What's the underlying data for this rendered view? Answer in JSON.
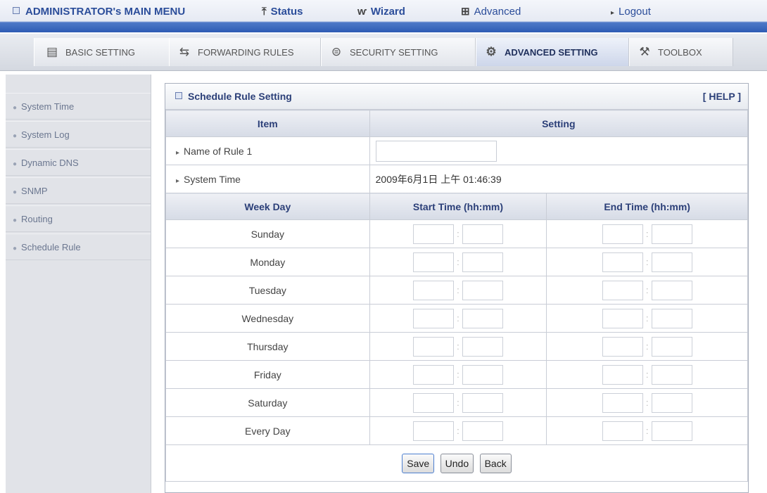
{
  "top_menu": {
    "admin": "ADMINISTRATOR's MAIN MENU",
    "status": "Status",
    "wizard": "Wizard",
    "advanced": "Advanced",
    "logout": "Logout"
  },
  "tabs": [
    {
      "label": "BASIC SETTING",
      "icon": "folder-icon"
    },
    {
      "label": "FORWARDING RULES",
      "icon": "arrows-icon"
    },
    {
      "label": "SECURITY SETTING",
      "icon": "lock-icon"
    },
    {
      "label": "ADVANCED SETTING",
      "icon": "settings-icon",
      "active": true
    },
    {
      "label": "TOOLBOX",
      "icon": "toolbox-icon"
    }
  ],
  "sidebar": {
    "items": [
      {
        "label": "System Time"
      },
      {
        "label": "System Log"
      },
      {
        "label": "Dynamic DNS"
      },
      {
        "label": "SNMP"
      },
      {
        "label": "Routing"
      },
      {
        "label": "Schedule Rule"
      }
    ]
  },
  "panel": {
    "title": "Schedule Rule Setting",
    "help": "[ HELP ]",
    "col_item": "Item",
    "col_setting": "Setting",
    "name_label": "Name of Rule 1",
    "name_value": "",
    "time_label": "System Time",
    "time_value": "2009年6月1日 上午 01:46:39",
    "col_weekday": "Week Day",
    "col_start": "Start Time (hh:mm)",
    "col_end": "End Time (hh:mm)",
    "days": [
      "Sunday",
      "Monday",
      "Tuesday",
      "Wednesday",
      "Thursday",
      "Friday",
      "Saturday",
      "Every Day"
    ],
    "buttons": {
      "save": "Save",
      "undo": "Undo",
      "back": "Back"
    }
  }
}
